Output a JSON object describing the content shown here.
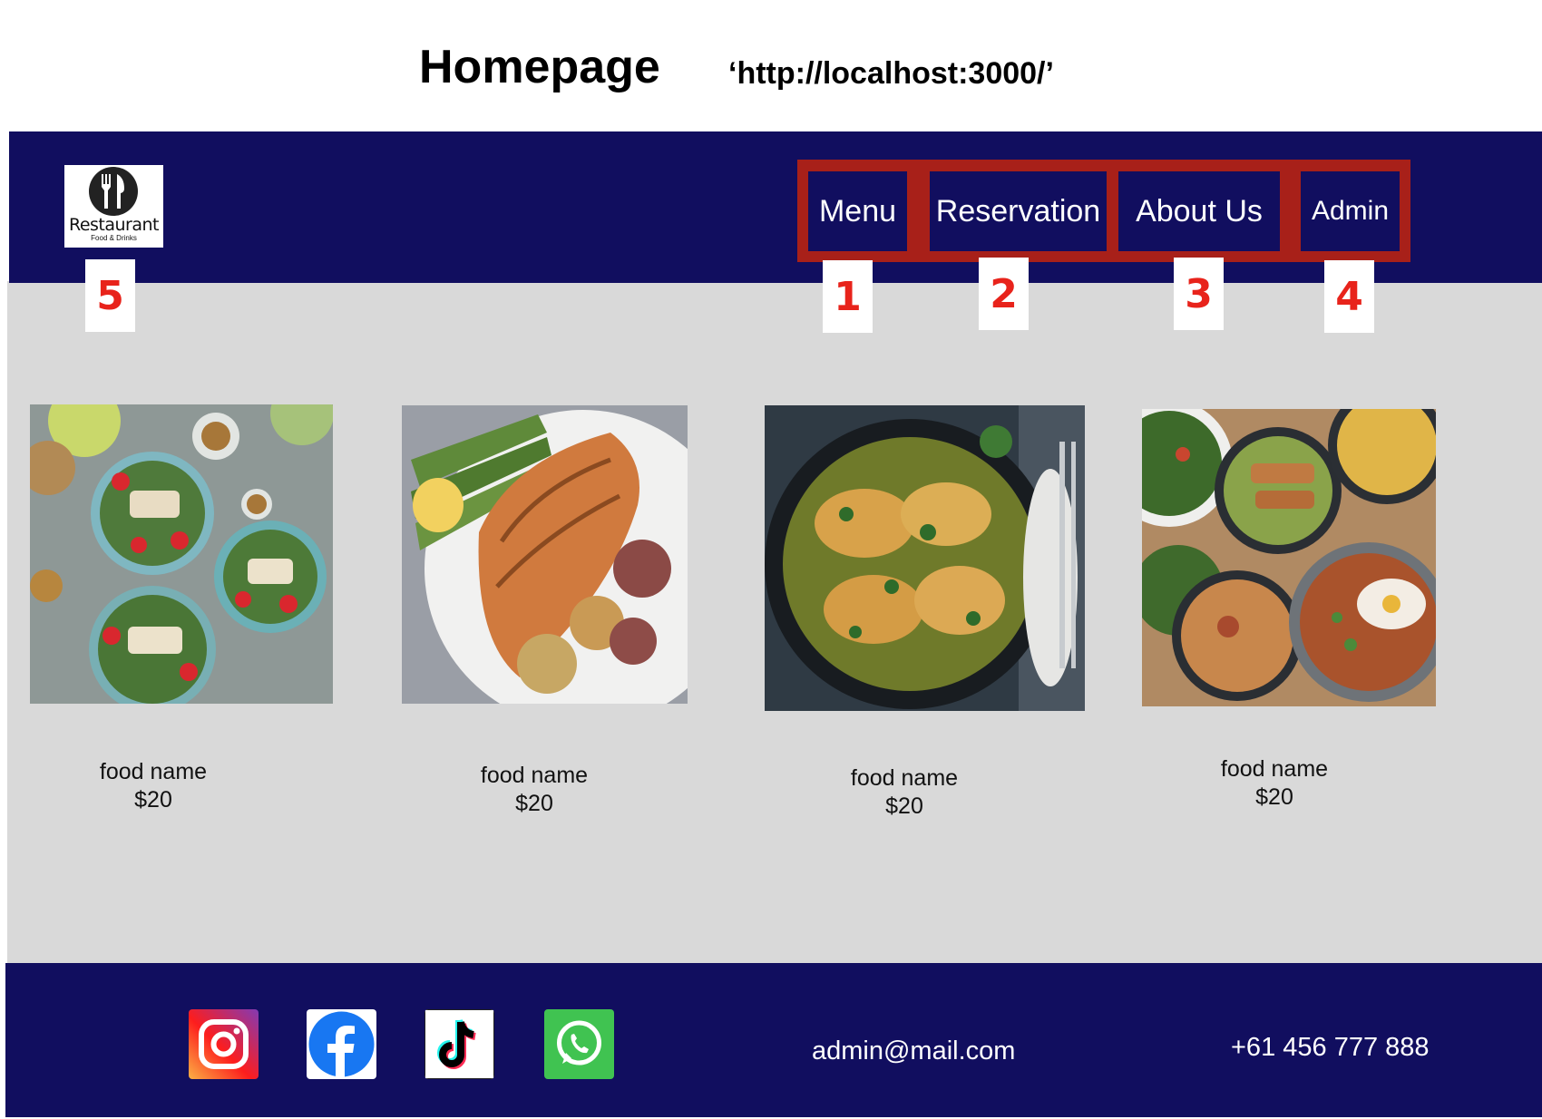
{
  "heading": {
    "title": "Homepage",
    "url": "‘http://localhost:3000/’"
  },
  "header": {
    "logo": {
      "name": "Restaurant",
      "tagline": "Food & Drinks",
      "icon": "fork-knife-icon"
    },
    "nav": [
      {
        "label": "Menu"
      },
      {
        "label": "Reservation"
      },
      {
        "label": "About Us"
      },
      {
        "label": "Admin"
      }
    ]
  },
  "annotations": [
    "1",
    "2",
    "3",
    "4",
    "5"
  ],
  "foods": [
    {
      "name": "food name",
      "price": "$20"
    },
    {
      "name": "food name",
      "price": "$20"
    },
    {
      "name": "food name",
      "price": "$20"
    },
    {
      "name": "food name",
      "price": "$20"
    }
  ],
  "footer": {
    "social": [
      {
        "icon": "instagram-icon"
      },
      {
        "icon": "facebook-icon"
      },
      {
        "icon": "tiktok-icon"
      },
      {
        "icon": "whatsapp-icon"
      }
    ],
    "email": "admin@mail.com",
    "phone": "+61 456 777 888"
  },
  "colors": {
    "nav_background": "#110e5f",
    "content_background": "#d9d9d9",
    "annotation_red": "#a82019",
    "badge_text": "#e8231b"
  }
}
